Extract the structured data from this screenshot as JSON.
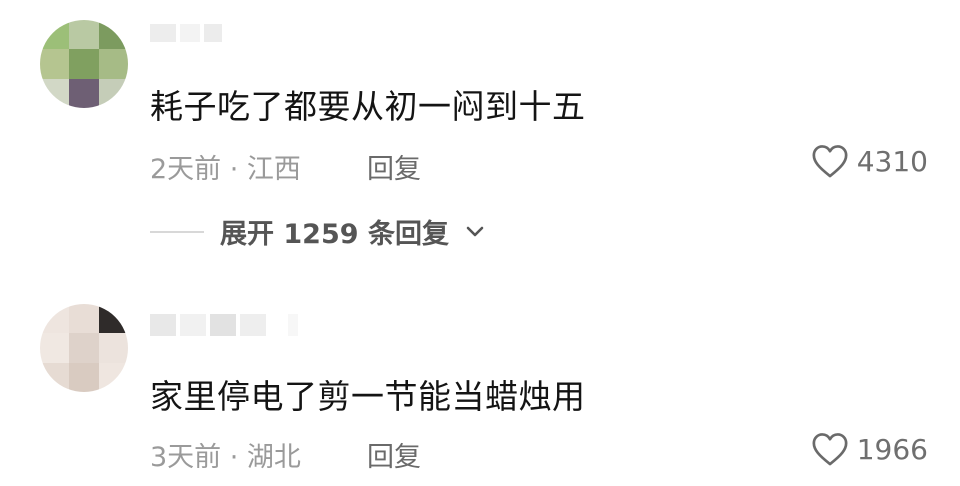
{
  "comments": [
    {
      "text": "耗子吃了都要从初一闷到十五",
      "meta": "2天前 · 江西",
      "reply_label": "回复",
      "likes": "4310",
      "expand_label": "展开 1259 条回复"
    },
    {
      "text": "家里停电了剪一节能当蜡烛用",
      "meta": "3天前 · 湖北",
      "reply_label": "回复",
      "likes": "1966"
    }
  ],
  "icons": {
    "like": "heart-outline-icon",
    "expand": "chevron-down-icon"
  }
}
